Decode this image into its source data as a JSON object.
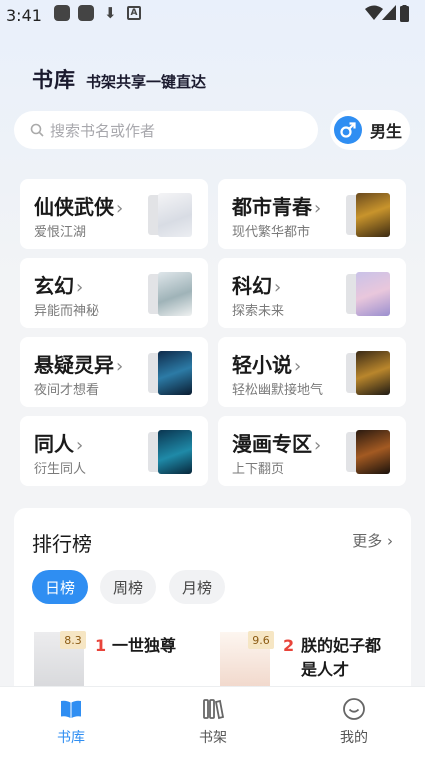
{
  "status_bar": {
    "time": "3:41"
  },
  "header": {
    "brand": "书库",
    "tagline": "书架共享一键直达"
  },
  "search": {
    "placeholder": "搜索书名或作者"
  },
  "gender": {
    "label": "男生"
  },
  "categories": [
    {
      "title": "仙侠武侠",
      "subtitle": "爱恨江湖"
    },
    {
      "title": "都市青春",
      "subtitle": "现代繁华都市"
    },
    {
      "title": "玄幻",
      "subtitle": "异能而神秘"
    },
    {
      "title": "科幻",
      "subtitle": "探索未来"
    },
    {
      "title": "悬疑灵异",
      "subtitle": "夜间才想看"
    },
    {
      "title": "轻小说",
      "subtitle": "轻松幽默接地气"
    },
    {
      "title": "同人",
      "subtitle": "衍生同人"
    },
    {
      "title": "漫画专区",
      "subtitle": "上下翻页"
    }
  ],
  "ranking": {
    "title": "排行榜",
    "more": "更多",
    "tabs": [
      "日榜",
      "周榜",
      "月榜"
    ],
    "items": [
      {
        "rank": "1",
        "score": "8.3",
        "name": "一世独尊"
      },
      {
        "rank": "2",
        "score": "9.6",
        "name_line1": "朕的妃子都",
        "name_line2": "是人才"
      }
    ]
  },
  "nav": {
    "items": [
      "书库",
      "书架",
      "我的"
    ]
  },
  "colors": {
    "accent": "#2f8ef2",
    "rank_number": "#e8443a"
  }
}
